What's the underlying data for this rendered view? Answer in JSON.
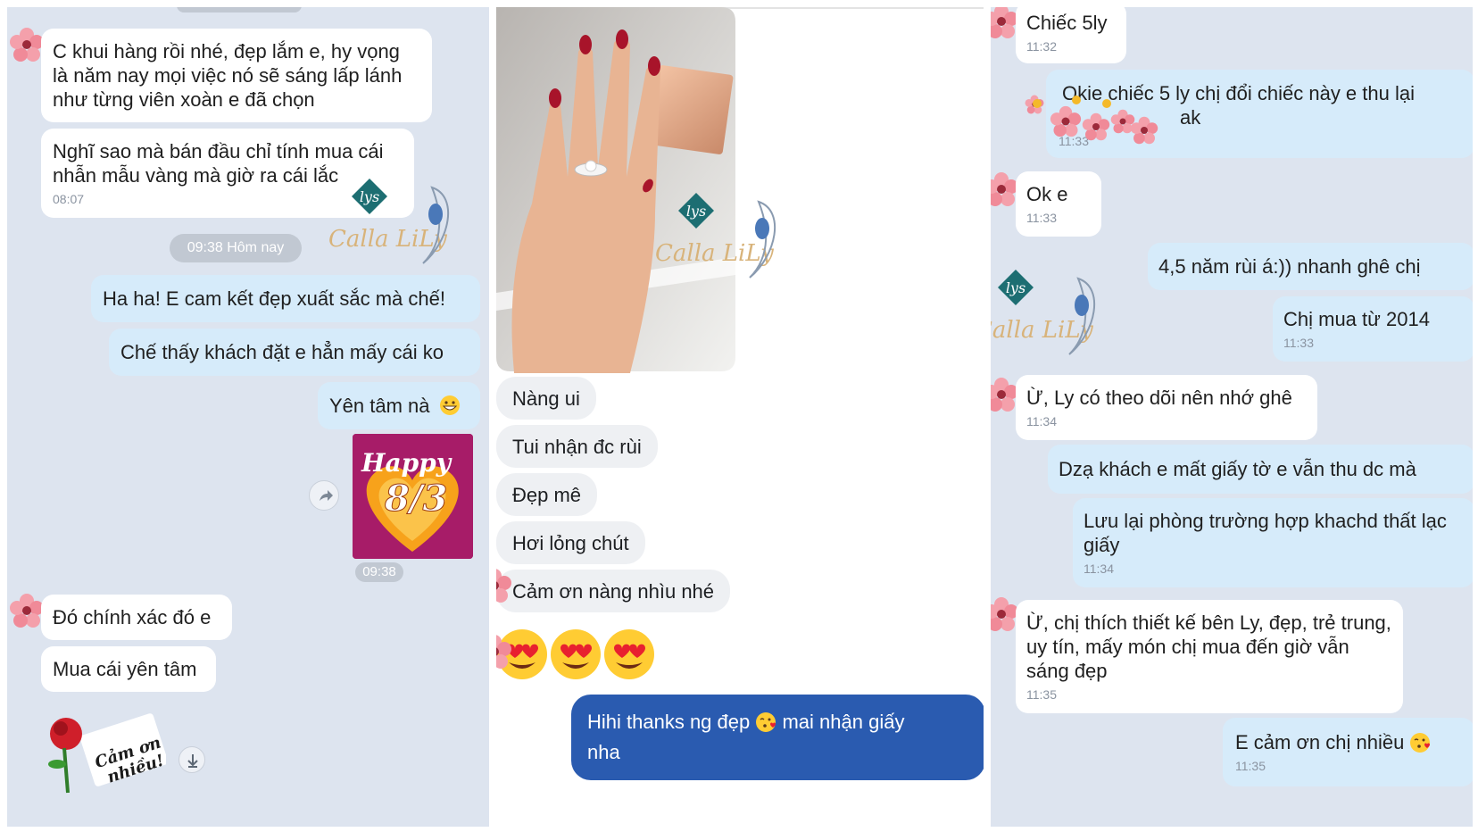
{
  "panel_left": {
    "messages_in": [
      {
        "text": "C khui hàng rồi nhé, đẹp lắm e, hy vọng là năm nay mọi việc nó sẽ sáng lấp lánh như từng viên xoàn e đã chọn"
      },
      {
        "text": "Nghĩ sao mà bán đầu chỉ tính mua cái nhẫn mẫu vàng mà giờ ra cái lắc",
        "time": "08:07"
      }
    ],
    "divider": "09:38 Hôm nay",
    "messages_out": [
      {
        "text": "Ha ha! E cam kết đẹp xuất sắc mà chế!"
      },
      {
        "text": "Chế thấy khách đặt e hẳn mấy cái ko"
      },
      {
        "text": "Yên tâm nà"
      }
    ],
    "sticker": {
      "line1": "Happy",
      "line2": "8/3",
      "time": "09:38"
    },
    "messages_in_2": [
      {
        "text": "Đó chính xác đó e"
      },
      {
        "text": "Mua cái yên tâm"
      }
    ],
    "rose_sticker": {
      "line1": "Cảm ơn",
      "line2": "nhiều!"
    }
  },
  "panel_middle": {
    "messages_in": [
      {
        "text": "Nàng ui"
      },
      {
        "text": "Tui nhận đc rùi"
      },
      {
        "text": "Đẹp mê"
      },
      {
        "text": "Hơi lỏng chút"
      },
      {
        "text": "Cảm ơn nàng nhìu nhé"
      }
    ],
    "message_out": {
      "text1": "Hihi thanks ng đẹp",
      "text2": " mai nhận giấy",
      "text3": "nha"
    }
  },
  "panel_right": {
    "messages": [
      {
        "text": "Chiếc 5ly",
        "time": "11:32"
      },
      {
        "text": "Okie chiếc 5 ly chị đổi chiếc này e thu lại",
        "text2": "ak",
        "time": "11:33"
      },
      {
        "text": "Ok e",
        "time": "11:33"
      },
      {
        "text": "4,5 năm rùi á:)) nhanh ghê chị"
      },
      {
        "text": "Chị mua từ 2014",
        "time": "11:33"
      },
      {
        "text": "Ừ, Ly có theo dõi nên nhớ ghê",
        "time": "11:34"
      },
      {
        "text": "Dzạ khách e mất giấy tờ e vẫn thu dc mà"
      },
      {
        "text": "Lưu lại phòng trường hợp khachd thất lạc giấy",
        "time": "11:34"
      },
      {
        "text": "Ừ, chị thích thiết kế bên Ly, đẹp, trẻ trung, uy tín, mấy món chị mua đến giờ vẫn sáng đẹp",
        "time": "11:35"
      },
      {
        "text": "E cảm ơn chị nhiều",
        "time": "11:35"
      }
    ]
  },
  "watermark": {
    "text": "Calla LiLy",
    "monogram": "lys"
  },
  "colors": {
    "panel_bg": "#dde4ef",
    "incoming_bubble": "#ffffff",
    "outgoing_bubble": "#d6ebfa",
    "messenger_outgoing": "#2a5bb0",
    "messenger_incoming": "#eef0f3",
    "watermark_gold": "#d8b37a",
    "watermark_teal": "#1d6e72"
  },
  "icons": [
    "flower-avatar-icon",
    "share-icon",
    "download-icon",
    "heart-eyes-emoji-icon",
    "grin-emoji-icon",
    "kiss-emoji-icon",
    "seen-indicator-icon"
  ]
}
